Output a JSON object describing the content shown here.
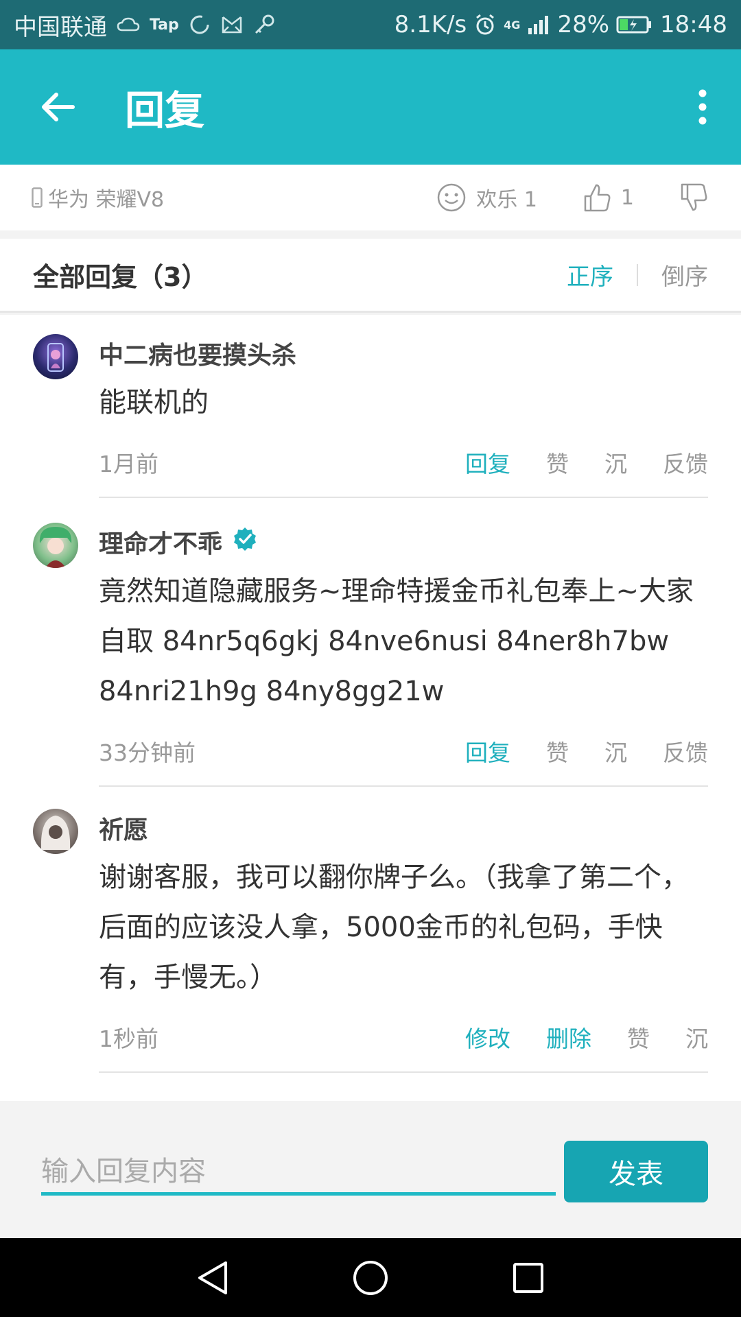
{
  "status_bar": {
    "carrier": "中国联通",
    "tap_label": "Tap",
    "speed": "8.1K/s",
    "network": "4G",
    "battery": "28%",
    "time": "18:48"
  },
  "app_bar": {
    "title": "回复"
  },
  "device_row": {
    "device": "华为 荣耀V8",
    "fun_label": "欢乐 1",
    "like_count": "1"
  },
  "list_header": {
    "title": "全部回复（3）",
    "sort_asc": "正序",
    "sort_desc": "倒序"
  },
  "comments": [
    {
      "name": "中二病也要摸头杀",
      "text": "能联机的",
      "time": "1月前",
      "actions": [
        "回复",
        "赞",
        "沉",
        "反馈"
      ]
    },
    {
      "name": "理命才不乖",
      "text": "竟然知道隐藏服务~理命特援金币礼包奉上~大家自取 84nr5q6gkj 84nve6nusi 84ner8h7bw 84nri21h9g 84ny8gg21w",
      "time": "33分钟前",
      "actions": [
        "回复",
        "赞",
        "沉",
        "反馈"
      ]
    },
    {
      "name": "祈愿",
      "text": "谢谢客服，我可以翻你牌子么。（我拿了第二个，后面的应该没人拿，5000金币的礼包码，手快有，手慢无。）",
      "time": "1秒前",
      "actions": [
        "修改",
        "删除",
        "赞",
        "沉"
      ]
    }
  ],
  "input_bar": {
    "placeholder": "输入回复内容",
    "send_label": "发表"
  },
  "colors": {
    "status_bar": "#1e6b74",
    "app_bar": "#1fb9c5",
    "accent": "#1fb0bd",
    "send_button": "#17a5b2"
  }
}
